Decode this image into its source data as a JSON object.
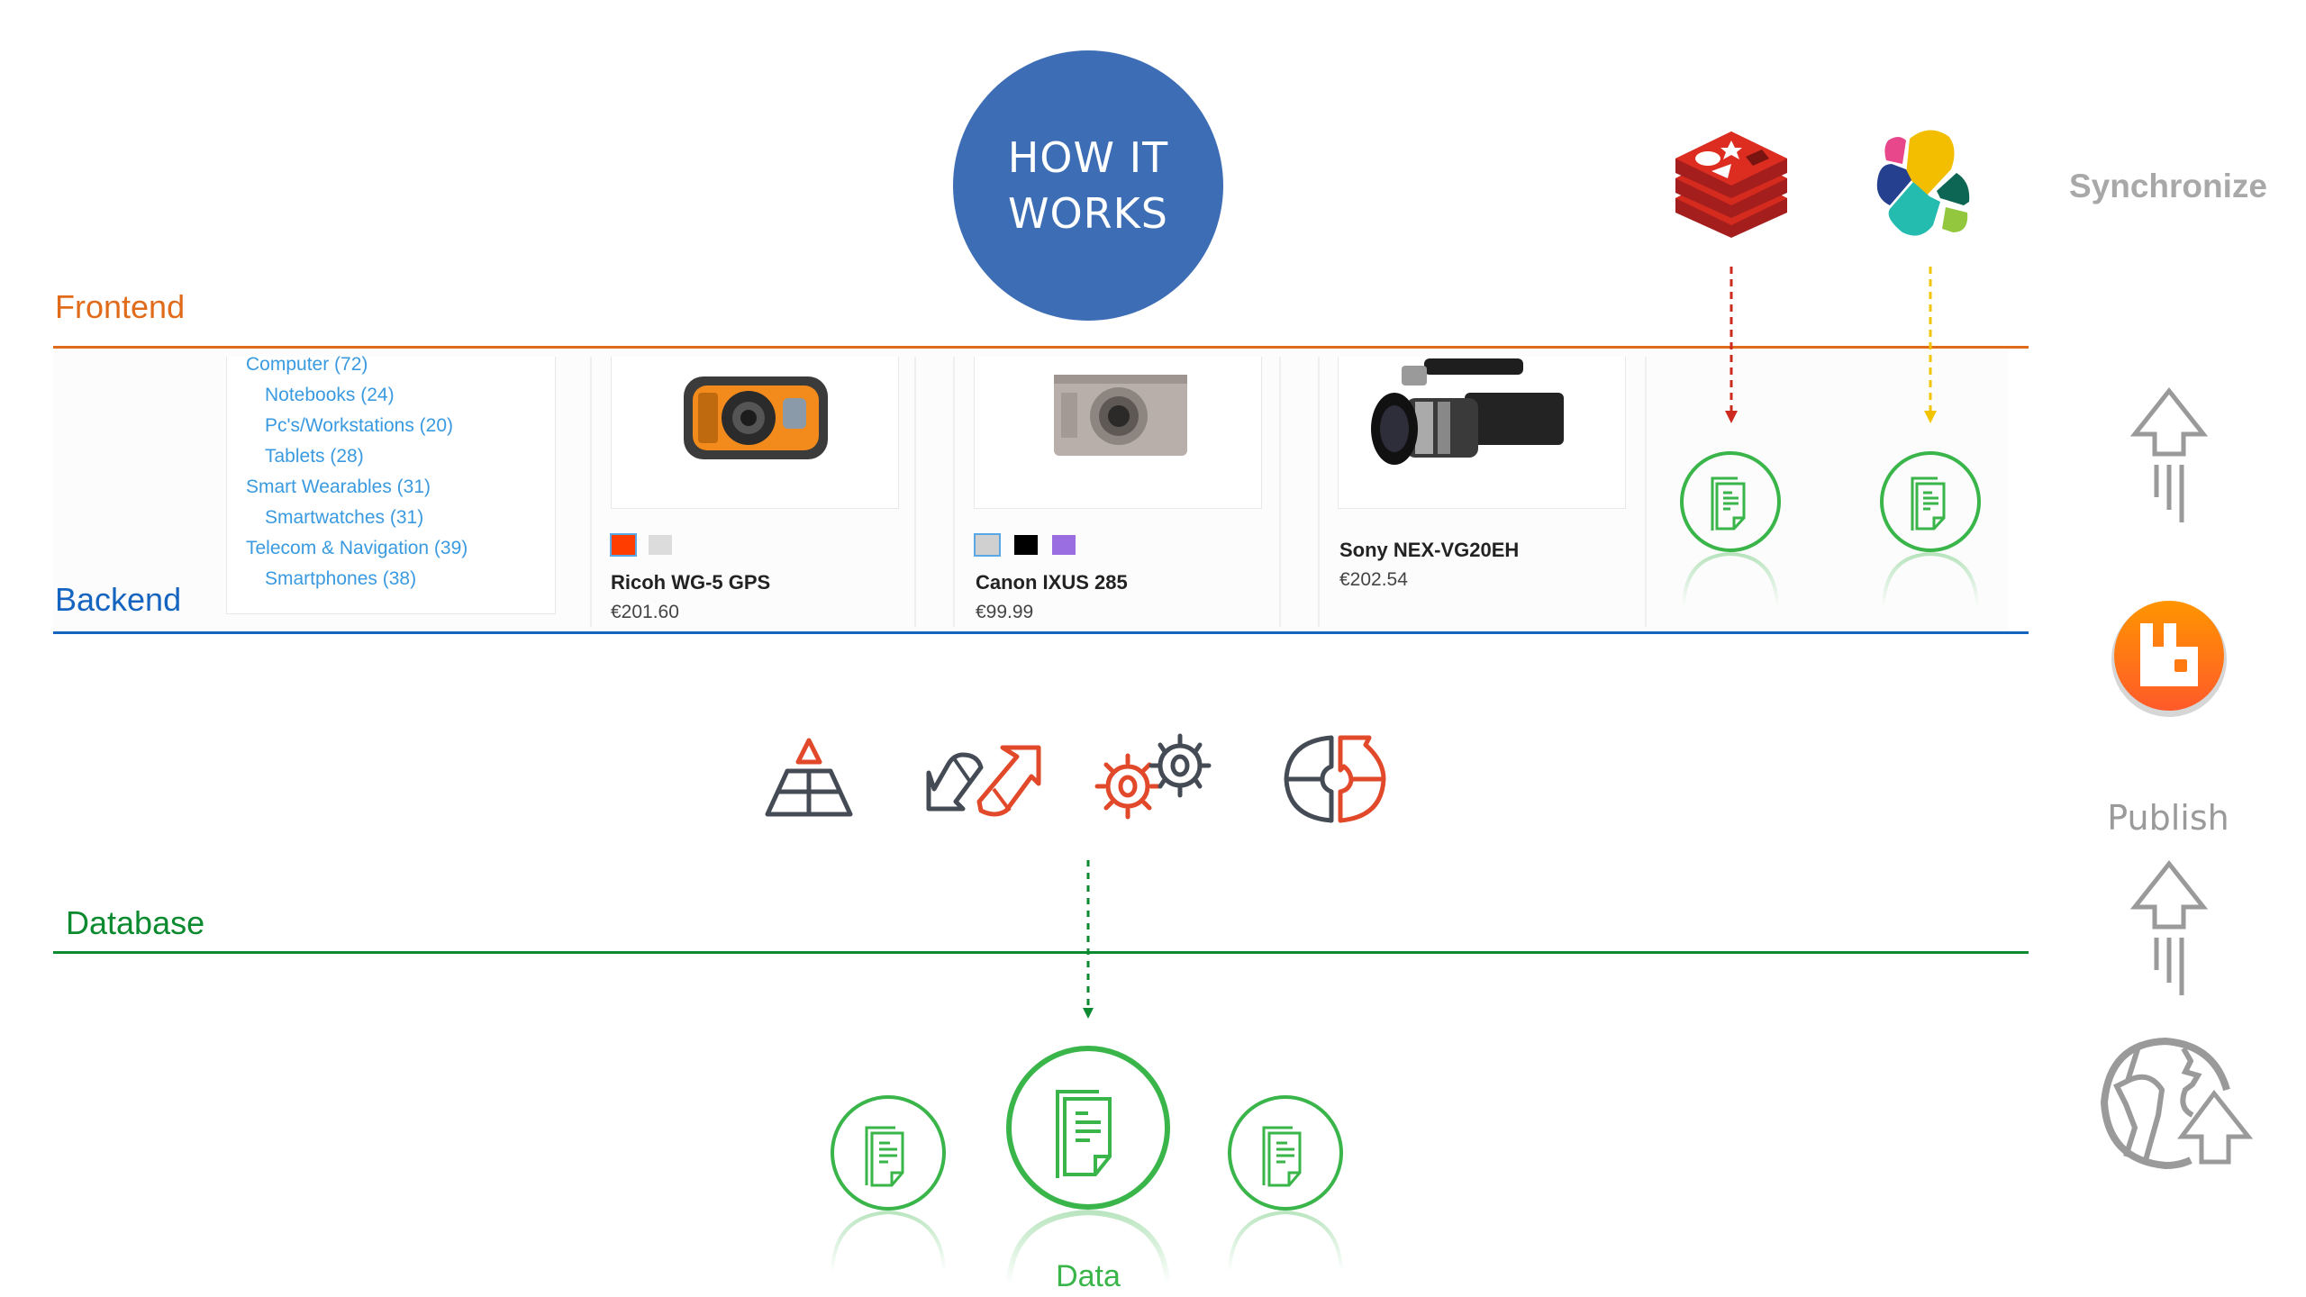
{
  "title": "HOW IT WORKS",
  "hero": {
    "line1": "HOW IT",
    "line2": "WORKS",
    "color": "#3d6db5"
  },
  "layers": {
    "frontend": {
      "label": "Frontend",
      "color": "#e06b1a"
    },
    "backend": {
      "label": "Backend",
      "color": "#1565c0"
    },
    "database": {
      "label": "Database",
      "color": "#0b8a2f"
    }
  },
  "categories": [
    {
      "label": "Computer (72)",
      "level": 0
    },
    {
      "label": "Notebooks (24)",
      "level": 1
    },
    {
      "label": "Pc's/Workstations (20)",
      "level": 1
    },
    {
      "label": "Tablets (28)",
      "level": 1
    },
    {
      "label": "Smart Wearables (31)",
      "level": 0
    },
    {
      "label": "Smartwatches (31)",
      "level": 1
    },
    {
      "label": "Telecom & Navigation (39)",
      "level": 0
    },
    {
      "label": "Smartphones (38)",
      "level": 1
    }
  ],
  "products": [
    {
      "name": "Ricoh WG-5 GPS",
      "price": "€201.60",
      "swatches": [
        "#ff3d00",
        "#dcdcdc"
      ],
      "image": "orange-rugged-camera"
    },
    {
      "name": "Canon IXUS 285",
      "price": "€99.99",
      "swatches": [
        "#d0d0d0",
        "#000000",
        "#9a6ee0"
      ],
      "image": "silver-compact-camera"
    },
    {
      "name": "Sony NEX-VG20EH",
      "price": "€202.54",
      "swatches": [],
      "image": "black-camcorder"
    }
  ],
  "sync": {
    "label": "Synchronize",
    "stores": [
      {
        "name": "redis-logo",
        "arrow_color": "#cc2a1e"
      },
      {
        "name": "elasticsearch-logo",
        "arrow_color": "#f2c400"
      }
    ]
  },
  "backend_icons": [
    "pyramid-icon",
    "exchange-arrows-icon",
    "gears-icon",
    "puzzle-circle-icon"
  ],
  "queue": {
    "name": "rabbitmq-logo",
    "color": "#ff6600"
  },
  "publish": {
    "label": "Publish"
  },
  "data": {
    "label": "Data",
    "color": "#39b54a"
  },
  "colors": {
    "accent_red": "#e2492a",
    "icon_dark": "#454b55",
    "gray": "#9a9a9a"
  }
}
